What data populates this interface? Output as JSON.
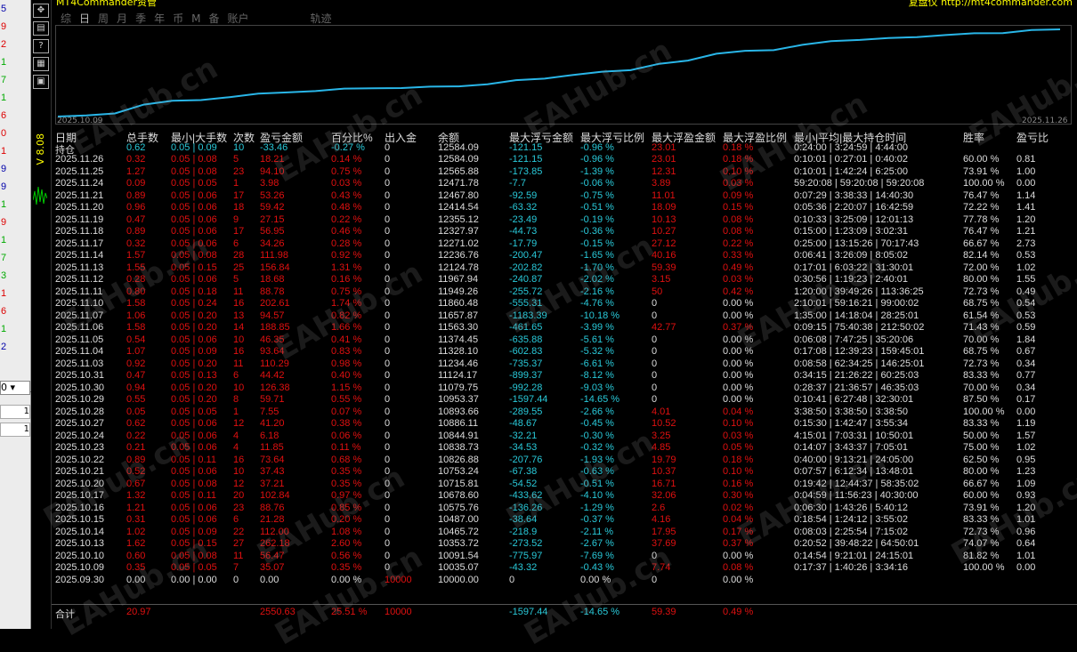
{
  "left_strip": {
    "digits": [
      {
        "t": "5",
        "c": "b"
      },
      {
        "t": "9",
        "c": "r"
      },
      {
        "t": "2",
        "c": "r"
      },
      {
        "t": "1",
        "c": "g"
      },
      {
        "t": "7",
        "c": "g"
      },
      {
        "t": "1",
        "c": "g"
      },
      {
        "t": "6",
        "c": "r"
      },
      {
        "t": "0",
        "c": "r"
      },
      {
        "t": "1",
        "c": "r"
      },
      {
        "t": "9",
        "c": "b"
      },
      {
        "t": "9",
        "c": "b"
      },
      {
        "t": "1",
        "c": "g"
      },
      {
        "t": "9",
        "c": "r"
      },
      {
        "t": "1",
        "c": "g"
      },
      {
        "t": "7",
        "c": "g"
      },
      {
        "t": "3",
        "c": "g"
      },
      {
        "t": "1",
        "c": "r"
      },
      {
        "t": "6",
        "c": "r"
      },
      {
        "t": "1",
        "c": "g"
      },
      {
        "t": "2",
        "c": "b"
      }
    ],
    "select_value": "0",
    "box_values": [
      "1",
      "1"
    ]
  },
  "toolbar": {
    "tools": [
      "move-icon",
      "calendar-icon",
      "help-icon",
      "grid-icon",
      "restore-icon"
    ],
    "tool_glyphs": [
      "✥",
      "▤",
      "?",
      "▦",
      "▣"
    ],
    "vertical_label": "V 8.08"
  },
  "top": {
    "title": "MT4Commander资管",
    "right": "复盘仪 http://mt4commander.com",
    "tabs": [
      "综",
      "日",
      "周",
      "月",
      "季",
      "年",
      "币",
      "M",
      "备",
      "账户"
    ],
    "selected_tab": "日",
    "track_label": "轨迹"
  },
  "chart_data": {
    "type": "line",
    "x_start": "2025.10.09",
    "x_end": "2025.11.26",
    "series": [
      {
        "values": [
          10000,
          10035.07,
          10091.54,
          10353.72,
          10465.72,
          10487,
          10575.76,
          10678.6,
          10715.81,
          10753.24,
          10826.88,
          10838.73,
          10844.91,
          10886.11,
          10893.66,
          10953.37,
          11079.75,
          11124.17,
          11234.46,
          11328.1,
          11374.45,
          11563.3,
          11657.87,
          11860.48,
          11949.26,
          11967.94,
          12124.78,
          12236.76,
          12271.02,
          12327.97,
          12355.12,
          12414.54,
          12467.8,
          12471.78,
          12565.88,
          12584.09
        ]
      }
    ],
    "color": "#29b6e8"
  },
  "table": {
    "headers": [
      "日期",
      "总手数",
      "最小|大手数",
      "次数",
      "盈亏金额",
      "百分比%",
      "出入金",
      "余额",
      "最大浮亏金额",
      "最大浮亏比例",
      "最大浮盈金额",
      "最大浮盈比例",
      "最小|平均|最大持仓时间",
      "胜率",
      "盈亏比"
    ],
    "rows": [
      [
        "持仓",
        "0.62",
        "0.05 | 0.09",
        "10",
        "-33.46",
        "-0.27 %",
        "0",
        "12584.09",
        "-121.15",
        "-0.96 %",
        "23.01",
        "0.18 %",
        "0:24:00 | 3:24:59 | 4:44:00",
        "",
        ""
      ],
      [
        "2025.11.26",
        "0.32",
        "0.05 | 0.08",
        "5",
        "18.21",
        "0.14 %",
        "0",
        "12584.09",
        "-121.15",
        "-0.96 %",
        "23.01",
        "0.18 %",
        "0:10:01 | 0:27:01 | 0:40:02",
        "60.00 %",
        "0.81"
      ],
      [
        "2025.11.25",
        "1.27",
        "0.05 | 0.08",
        "23",
        "94.10",
        "0.75 %",
        "0",
        "12565.88",
        "-173.85",
        "-1.39 %",
        "12.31",
        "0.10 %",
        "0:10:01 | 1:42:24 | 6:25:00",
        "73.91 %",
        "1.00"
      ],
      [
        "2025.11.24",
        "0.09",
        "0.05 | 0.05",
        "1",
        "3.98",
        "0.03 %",
        "0",
        "12471.78",
        "-7.7",
        "-0.06 %",
        "3.89",
        "0.03 %",
        "59:20:08 | 59:20:08 | 59:20:08",
        "100.00 %",
        "0.00"
      ],
      [
        "2025.11.21",
        "0.89",
        "0.05 | 0.06",
        "17",
        "53.26",
        "0.43 %",
        "0",
        "12467.80",
        "-92.59",
        "-0.75 %",
        "11.01",
        "0.09 %",
        "0:07:29 | 3:38:33 | 14:40:30",
        "76.47 %",
        "1.14"
      ],
      [
        "2025.11.20",
        "0.96",
        "0.05 | 0.06",
        "18",
        "59.42",
        "0.48 %",
        "0",
        "12414.54",
        "-63.32",
        "-0.51 %",
        "18.09",
        "0.15 %",
        "0:05:36 | 2:20:07 | 16:42:59",
        "72.22 %",
        "1.41"
      ],
      [
        "2025.11.19",
        "0.47",
        "0.05 | 0.06",
        "9",
        "27.15",
        "0.22 %",
        "0",
        "12355.12",
        "-23.49",
        "-0.19 %",
        "10.13",
        "0.08 %",
        "0:10:33 | 3:25:09 | 12:01:13",
        "77.78 %",
        "1.20"
      ],
      [
        "2025.11.18",
        "0.89",
        "0.05 | 0.06",
        "17",
        "56.95",
        "0.46 %",
        "0",
        "12327.97",
        "-44.73",
        "-0.36 %",
        "10.27",
        "0.08 %",
        "0:15:00 | 1:23:09 | 3:02:31",
        "76.47 %",
        "1.21"
      ],
      [
        "2025.11.17",
        "0.32",
        "0.05 | 0.06",
        "6",
        "34.26",
        "0.28 %",
        "0",
        "12271.02",
        "-17.79",
        "-0.15 %",
        "27.12",
        "0.22 %",
        "0:25:00 | 13:15:26 | 70:17:43",
        "66.67 %",
        "2.73"
      ],
      [
        "2025.11.14",
        "1.57",
        "0.05 | 0.08",
        "28",
        "111.98",
        "0.92 %",
        "0",
        "12236.76",
        "-200.47",
        "-1.65 %",
        "40.16",
        "0.33 %",
        "0:06:41 | 3:26:09 | 8:05:02",
        "82.14 %",
        "0.53"
      ],
      [
        "2025.11.13",
        "1.55",
        "0.05 | 0.15",
        "25",
        "156.84",
        "1.31 %",
        "0",
        "12124.78",
        "-202.82",
        "-1.70 %",
        "59.39",
        "0.49 %",
        "0:17:01 | 6:03:22 | 31:30:01",
        "72.00 %",
        "1.02"
      ],
      [
        "2025.11.12",
        "0.28",
        "0.05 | 0.06",
        "5",
        "18.68",
        "0.16 %",
        "0",
        "11967.94",
        "-240.87",
        "-2.02 %",
        "3.15",
        "0.03 %",
        "0:30:56 | 1:19:23 | 2:40:01",
        "80.00 %",
        "1.55"
      ],
      [
        "2025.11.11",
        "0.80",
        "0.05 | 0.18",
        "11",
        "88.78",
        "0.75 %",
        "0",
        "11949.26",
        "-255.72",
        "-2.16 %",
        "50",
        "0.42 %",
        "1:20:00 | 39:49:26 | 113:36:25",
        "72.73 %",
        "0.49"
      ],
      [
        "2025.11.10",
        "1.58",
        "0.05 | 0.24",
        "16",
        "202.61",
        "1.74 %",
        "0",
        "11860.48",
        "-555.31",
        "-4.76 %",
        "0",
        "0.00 %",
        "2:10:01 | 59:16:21 | 99:00:02",
        "68.75 %",
        "0.54"
      ],
      [
        "2025.11.07",
        "1.06",
        "0.05 | 0.20",
        "13",
        "94.57",
        "0.82 %",
        "0",
        "11657.87",
        "-1183.39",
        "-10.18 %",
        "0",
        "0.00 %",
        "1:35:00 | 14:18:04 | 28:25:01",
        "61.54 %",
        "0.53"
      ],
      [
        "2025.11.06",
        "1.58",
        "0.05 | 0.20",
        "14",
        "188.85",
        "1.66 %",
        "0",
        "11563.30",
        "-461.65",
        "-3.99 %",
        "42.77",
        "0.37 %",
        "0:09:15 | 75:40:38 | 212:50:02",
        "71.43 %",
        "0.59"
      ],
      [
        "2025.11.05",
        "0.54",
        "0.05 | 0.06",
        "10",
        "46.35",
        "0.41 %",
        "0",
        "11374.45",
        "-635.88",
        "-5.61 %",
        "0",
        "0.00 %",
        "0:06:08 | 7:47:25 | 35:20:06",
        "70.00 %",
        "1.84"
      ],
      [
        "2025.11.04",
        "1.07",
        "0.05 | 0.09",
        "16",
        "93.64",
        "0.83 %",
        "0",
        "11328.10",
        "-602.83",
        "-5.32 %",
        "0",
        "0.00 %",
        "0:17:08 | 12:39:23 | 159:45:01",
        "68.75 %",
        "0.67"
      ],
      [
        "2025.11.03",
        "0.92",
        "0.05 | 0.20",
        "11",
        "110.29",
        "0.98 %",
        "0",
        "11234.46",
        "-735.37",
        "-6.61 %",
        "0",
        "0.00 %",
        "0:08:58 | 62:34:25 | 146:25:01",
        "72.73 %",
        "0.34"
      ],
      [
        "2025.10.31",
        "0.47",
        "0.05 | 0.13",
        "6",
        "44.42",
        "0.40 %",
        "0",
        "11124.17",
        "-899.37",
        "-8.12 %",
        "0",
        "0.00 %",
        "0:34:15 | 21:26:22 | 60:25:03",
        "83.33 %",
        "0.77"
      ],
      [
        "2025.10.30",
        "0.94",
        "0.05 | 0.20",
        "10",
        "126.38",
        "1.15 %",
        "0",
        "11079.75",
        "-992.28",
        "-9.03 %",
        "0",
        "0.00 %",
        "0:28:37 | 21:36:57 | 46:35:03",
        "70.00 %",
        "0.34"
      ],
      [
        "2025.10.29",
        "0.55",
        "0.05 | 0.20",
        "8",
        "59.71",
        "0.55 %",
        "0",
        "10953.37",
        "-1597.44",
        "-14.65 %",
        "0",
        "0.00 %",
        "0:10:41 | 6:27:48 | 32:30:01",
        "87.50 %",
        "0.17"
      ],
      [
        "2025.10.28",
        "0.05",
        "0.05 | 0.05",
        "1",
        "7.55",
        "0.07 %",
        "0",
        "10893.66",
        "-289.55",
        "-2.66 %",
        "4.01",
        "0.04 %",
        "3:38:50 | 3:38:50 | 3:38:50",
        "100.00 %",
        "0.00"
      ],
      [
        "2025.10.27",
        "0.62",
        "0.05 | 0.06",
        "12",
        "41.20",
        "0.38 %",
        "0",
        "10886.11",
        "-48.67",
        "-0.45 %",
        "10.52",
        "0.10 %",
        "0:15:30 | 1:42:47 | 3:55:34",
        "83.33 %",
        "1.19"
      ],
      [
        "2025.10.24",
        "0.22",
        "0.05 | 0.06",
        "4",
        "6.18",
        "0.06 %",
        "0",
        "10844.91",
        "-32.21",
        "-0.30 %",
        "3.25",
        "0.03 %",
        "4:15:01 | 7:03:31 | 10:50:01",
        "50.00 %",
        "1.57"
      ],
      [
        "2025.10.23",
        "0.21",
        "0.05 | 0.06",
        "4",
        "11.85",
        "0.11 %",
        "0",
        "10838.73",
        "-34.53",
        "-0.32 %",
        "4.85",
        "0.05 %",
        "0:14:07 | 3:43:37 | 7:05:01",
        "75.00 %",
        "1.02"
      ],
      [
        "2025.10.22",
        "0.89",
        "0.05 | 0.11",
        "16",
        "73.64",
        "0.68 %",
        "0",
        "10826.88",
        "-207.76",
        "-1.93 %",
        "19.79",
        "0.18 %",
        "0:40:00 | 9:13:21 | 24:05:00",
        "62.50 %",
        "0.95"
      ],
      [
        "2025.10.21",
        "0.52",
        "0.05 | 0.06",
        "10",
        "37.43",
        "0.35 %",
        "0",
        "10753.24",
        "-67.38",
        "-0.63 %",
        "10.37",
        "0.10 %",
        "0:07:57 | 6:12:34 | 13:48:01",
        "80.00 %",
        "1.23"
      ],
      [
        "2025.10.20",
        "0.67",
        "0.05 | 0.08",
        "12",
        "37.21",
        "0.35 %",
        "0",
        "10715.81",
        "-54.52",
        "-0.51 %",
        "16.71",
        "0.16 %",
        "0:19:42 | 12:44:37 | 58:35:02",
        "66.67 %",
        "1.09"
      ],
      [
        "2025.10.17",
        "1.32",
        "0.05 | 0.11",
        "20",
        "102.84",
        "0.97 %",
        "0",
        "10678.60",
        "-433.62",
        "-4.10 %",
        "32.06",
        "0.30 %",
        "0:04:59 | 11:56:23 | 40:30:00",
        "60.00 %",
        "0.93"
      ],
      [
        "2025.10.16",
        "1.21",
        "0.05 | 0.06",
        "23",
        "88.76",
        "0.85 %",
        "0",
        "10575.76",
        "-136.26",
        "-1.29 %",
        "2.6",
        "0.02 %",
        "0:06:30 | 1:43:26 | 5:40:12",
        "73.91 %",
        "1.20"
      ],
      [
        "2025.10.15",
        "0.31",
        "0.05 | 0.06",
        "6",
        "21.28",
        "0.20 %",
        "0",
        "10487.00",
        "-38.64",
        "-0.37 %",
        "4.16",
        "0.04 %",
        "0:18:54 | 1:24:12 | 3:55:02",
        "83.33 %",
        "1.01"
      ],
      [
        "2025.10.14",
        "1.02",
        "0.05 | 0.09",
        "22",
        "112.00",
        "1.08 %",
        "0",
        "10465.72",
        "-218.9",
        "-2.11 %",
        "17.95",
        "0.17 %",
        "0:08:03 | 2:25:54 | 7:15:02",
        "72.73 %",
        "0.96"
      ],
      [
        "2025.10.13",
        "1.62",
        "0.05 | 0.15",
        "27",
        "262.18",
        "2.60 %",
        "0",
        "10353.72",
        "-273.52",
        "-2.67 %",
        "37.69",
        "0.37 %",
        "0:20:52 | 39:48:22 | 64:50:01",
        "74.07 %",
        "0.64"
      ],
      [
        "2025.10.10",
        "0.60",
        "0.05 | 0.08",
        "11",
        "56.47",
        "0.56 %",
        "0",
        "10091.54",
        "-775.97",
        "-7.69 %",
        "0",
        "0.00 %",
        "0:14:54 | 9:21:01 | 24:15:01",
        "81.82 %",
        "1.01"
      ],
      [
        "2025.10.09",
        "0.35",
        "0.05 | 0.05",
        "7",
        "35.07",
        "0.35 %",
        "0",
        "10035.07",
        "-43.32",
        "-0.43 %",
        "7.74",
        "0.08 %",
        "0:17:37 | 1:40:26 | 3:34:16",
        "100.00 %",
        "0.00"
      ],
      [
        "2025.09.30",
        "0.00",
        "0.00 | 0.00",
        "0",
        "0.00",
        "0.00 %",
        "10000",
        "10000.00",
        "0",
        "0.00 %",
        "0",
        "0.00 %",
        "",
        "",
        ""
      ]
    ],
    "summary": [
      "合计",
      "20.97",
      "",
      "",
      "2550.63",
      "25.51 %",
      "10000",
      "",
      "-1597.44",
      "-14.65 %",
      "59.39",
      "0.49 %",
      "",
      "",
      ""
    ]
  },
  "watermark": "EAHub.cn"
}
